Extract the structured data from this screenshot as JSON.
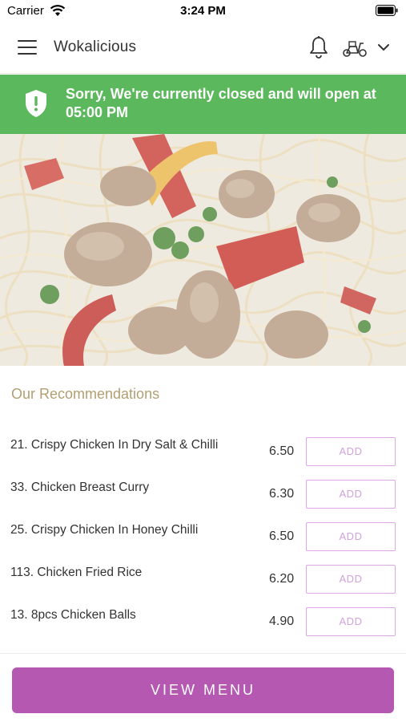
{
  "status_bar": {
    "carrier": "Carrier",
    "time": "3:24 PM"
  },
  "header": {
    "title": "Wokalicious"
  },
  "banner": {
    "message": "Sorry, We're currently closed and will open at 05:00 PM",
    "color": "#5cb85c"
  },
  "recommendations": {
    "title": "Our Recommendations",
    "items": [
      {
        "name": "21. Crispy Chicken In Dry Salt & Chilli",
        "price": "6.50",
        "button": "ADD"
      },
      {
        "name": "33. Chicken Breast Curry",
        "price": "6.30",
        "button": "ADD"
      },
      {
        "name": "25. Crispy Chicken In Honey Chilli",
        "price": "6.50",
        "button": "ADD"
      },
      {
        "name": "113. Chicken Fried Rice",
        "price": "6.20",
        "button": "ADD"
      },
      {
        "name": "13. 8pcs Chicken Balls",
        "price": "4.90",
        "button": "ADD"
      }
    ]
  },
  "footer": {
    "view_menu_label": "VIEW MENU",
    "accent": "#b458b2"
  },
  "icons": [
    "wifi-icon",
    "battery-icon",
    "menu-icon",
    "bell-icon",
    "scooter-icon",
    "chevron-down-icon",
    "shield-icon"
  ]
}
